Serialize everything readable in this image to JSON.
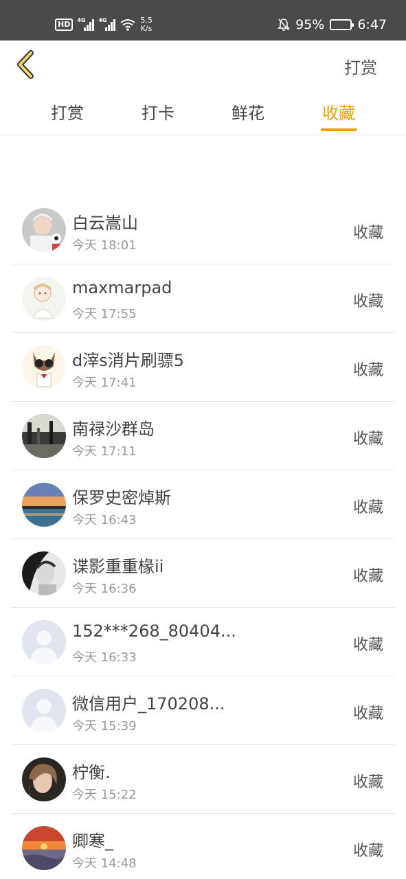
{
  "status_bar": {
    "hd": "HD",
    "sim1": "4G",
    "sim2": "4G",
    "speed_value": "5.5",
    "speed_unit": "K/s",
    "battery": "95%",
    "time": "6:47",
    "icons": [
      "hd-icon",
      "signal-icon",
      "wifi-icon",
      "bell-off-icon",
      "battery-icon"
    ]
  },
  "header": {
    "back_icon": "chevron-left-icon",
    "title": "打赏"
  },
  "tabs": [
    {
      "label": "打赏",
      "active": false
    },
    {
      "label": "打卡",
      "active": false
    },
    {
      "label": "鲜花",
      "active": false
    },
    {
      "label": "收藏",
      "active": true
    }
  ],
  "colors": {
    "accent": "#f0a100",
    "status_bar_bg": "#4a4a4a"
  },
  "list": [
    {
      "name": "白云嵩山",
      "time": "今天 18:01",
      "action": "收藏",
      "avatar": "photo-avatar"
    },
    {
      "name": "maxmarpad",
      "time": "今天 17:55",
      "action": "收藏",
      "avatar": "cartoon-avatar"
    },
    {
      "name": "d滓s消片刷骠5",
      "time": "今天 17:41",
      "action": "收藏",
      "avatar": "cat-avatar"
    },
    {
      "name": "南禄沙群岛",
      "time": "今天 17:11",
      "action": "收藏",
      "avatar": "photo-avatar"
    },
    {
      "name": "保罗史密焯斯",
      "time": "今天 16:43",
      "action": "收藏",
      "avatar": "sunset-avatar"
    },
    {
      "name": "谍影重重椽ii",
      "time": "今天 16:36",
      "action": "收藏",
      "avatar": "photo-avatar"
    },
    {
      "name": "152***268_80404...",
      "time": "今天 16:33",
      "action": "收藏",
      "avatar": "default-avatar"
    },
    {
      "name": "微信用户_170208...",
      "time": "今天 15:39",
      "action": "收藏",
      "avatar": "default-avatar"
    },
    {
      "name": "柠衡.",
      "time": "今天 15:22",
      "action": "收藏",
      "avatar": "photo-avatar"
    },
    {
      "name": "卿寒_",
      "time": "今天 14:48",
      "action": "收藏",
      "avatar": "sunset-avatar"
    }
  ]
}
